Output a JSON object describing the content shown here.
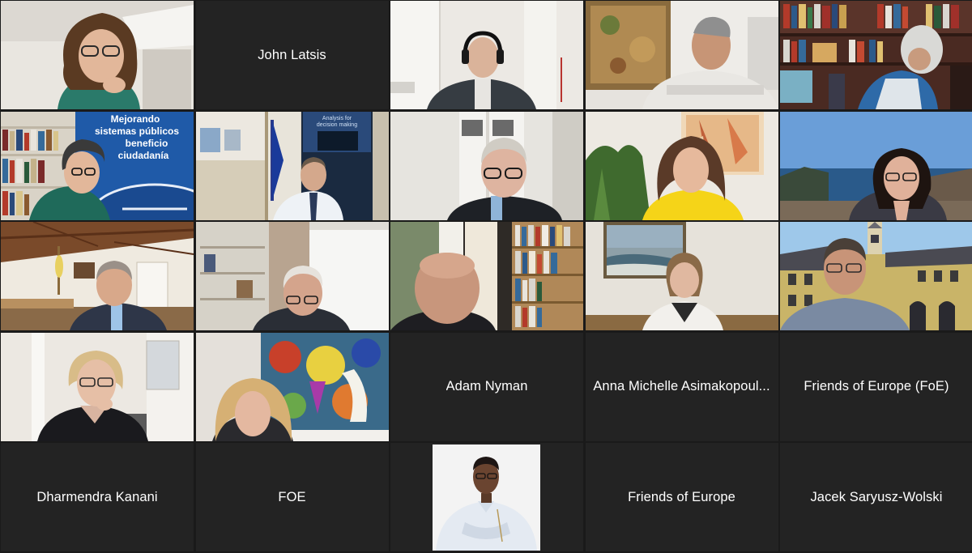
{
  "meeting": {
    "participants": [
      {
        "id": "p01",
        "display": "video",
        "scene": "woman-glasses-white-room",
        "name": ""
      },
      {
        "id": "p02",
        "display": "name",
        "name": "John Latsis"
      },
      {
        "id": "p03",
        "display": "video",
        "scene": "man-headphones-white-room",
        "name": ""
      },
      {
        "id": "p04",
        "display": "video",
        "scene": "man-arms-crossed-painting",
        "name": ""
      },
      {
        "id": "p05",
        "display": "video",
        "scene": "person-bookshelf",
        "name": ""
      },
      {
        "id": "p06",
        "display": "video",
        "scene": "woman-banner",
        "name": "",
        "banner_text": [
          "Mejorando",
          "sistemas públicos",
          "beneficio",
          "ciudadanía"
        ]
      },
      {
        "id": "p07",
        "display": "video",
        "scene": "man-office-flag",
        "name": "",
        "poster_text": [
          "Analysis for",
          "decision making"
        ]
      },
      {
        "id": "p08",
        "display": "video",
        "scene": "older-man-glasses-door",
        "name": ""
      },
      {
        "id": "p09",
        "display": "video",
        "scene": "woman-yellow-top",
        "name": ""
      },
      {
        "id": "p10",
        "display": "video",
        "scene": "woman-seaside",
        "name": ""
      },
      {
        "id": "p11",
        "display": "video",
        "scene": "man-attic",
        "name": ""
      },
      {
        "id": "p12",
        "display": "video",
        "scene": "older-man-shelves",
        "name": ""
      },
      {
        "id": "p13",
        "display": "video",
        "scene": "bald-man-books",
        "name": ""
      },
      {
        "id": "p14",
        "display": "video",
        "scene": "woman-seascape-painting",
        "name": ""
      },
      {
        "id": "p15",
        "display": "video",
        "scene": "man-manor-house",
        "name": ""
      },
      {
        "id": "p16",
        "display": "video",
        "scene": "woman-short-hair-glasses",
        "name": ""
      },
      {
        "id": "p17",
        "display": "video",
        "scene": "woman-blonde-abstract-art",
        "name": ""
      },
      {
        "id": "p18",
        "display": "name",
        "name": "Adam Nyman"
      },
      {
        "id": "p19",
        "display": "name",
        "name": "Anna Michelle Asimakopoul..."
      },
      {
        "id": "p20",
        "display": "name",
        "name": "Friends of Europe (FoE)"
      },
      {
        "id": "p21",
        "display": "name",
        "name": "Dharmendra Kanani"
      },
      {
        "id": "p22",
        "display": "name",
        "name": "FOE"
      },
      {
        "id": "p23",
        "display": "photo",
        "scene": "profile-photo-white-shirt",
        "name": ""
      },
      {
        "id": "p24",
        "display": "name",
        "name": "Friends of Europe"
      },
      {
        "id": "p25",
        "display": "name",
        "name": "Jacek Saryusz-Wolski"
      }
    ]
  },
  "colors": {
    "background": "#1a1a1a",
    "tile": "#232323",
    "name_text": "#ffffff"
  }
}
